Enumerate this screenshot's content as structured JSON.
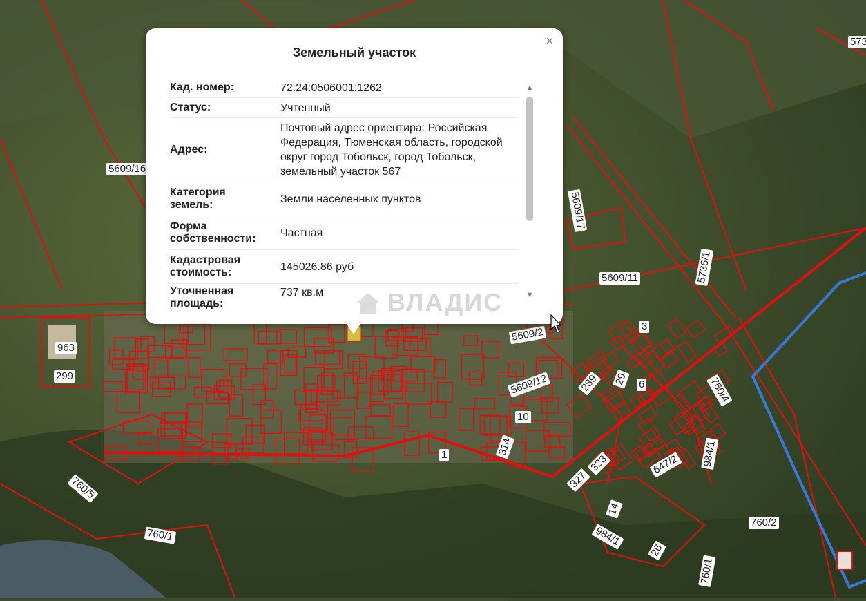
{
  "popup": {
    "title": "Земельный участок",
    "close_icon": "close-icon",
    "rows": [
      {
        "key": "Кад. номер:",
        "value": "72:24:0506001:1262"
      },
      {
        "key": "Статус:",
        "value": "Учтенный"
      },
      {
        "key": "Адрес:",
        "value": "Почтовый адрес ориентира: Российская Федерация, Тюменская область, городской округ город Тобольск, город Тобольск, земельный участок 567"
      },
      {
        "key": "Категория земель:",
        "value": "Земли населенных пунктов"
      },
      {
        "key": "Форма собственности:",
        "value": "Частная"
      },
      {
        "key": "Кадастровая стоимость:",
        "value": "145026.86 руб"
      },
      {
        "key": "Уточненная площадь:",
        "value": "737 кв.м"
      }
    ],
    "watermark": "ВЛАДИС"
  },
  "map_labels": [
    "5609/16",
    "5609/17",
    "5609/11",
    "5736/1",
    "5609/2",
    "5609/12",
    "3",
    "6",
    "29",
    "289",
    "963",
    "299",
    "760/4",
    "10",
    "1",
    "314",
    "323",
    "327",
    "647/2",
    "984/1",
    "760/5",
    "760/1",
    "760/2",
    "14",
    "984/1",
    "26",
    "760/1",
    "573"
  ],
  "colors": {
    "parcel_line": "#e01010",
    "boundary_line": "#3a78d8",
    "highlight": "#e8d040"
  }
}
